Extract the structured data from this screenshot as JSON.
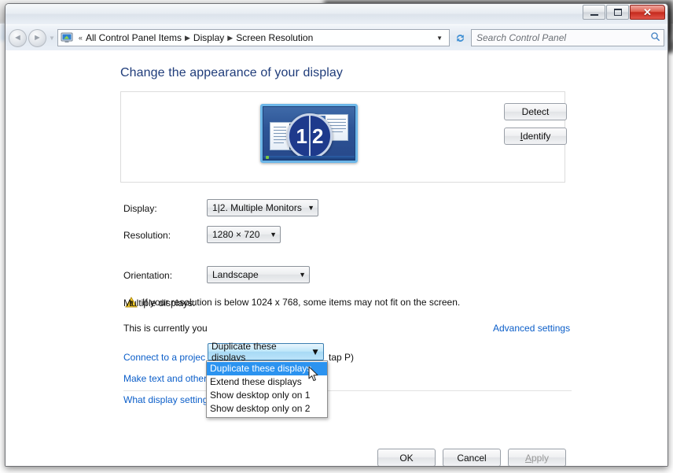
{
  "window": {
    "minimize_label": "Minimize",
    "maximize_label": "Maximize",
    "close_label": "✕"
  },
  "addressbar": {
    "back_glyph": "◄",
    "forward_glyph": "►",
    "history_glyph": "▼",
    "crumb_icon": "display-icon",
    "overflow": "«",
    "crumbs": [
      "All Control Panel Items",
      "Display",
      "Screen Resolution"
    ],
    "separator": "▶",
    "dropdown_glyph": "▼",
    "refresh_glyph": "↻",
    "search_placeholder": "Search Control Panel",
    "search_glyph": "⌕"
  },
  "main": {
    "page_title": "Change the appearance of your display",
    "preview": {
      "badge_left": "1",
      "badge_right": "2"
    },
    "buttons": {
      "detect": "Detect",
      "identify_pre": "I",
      "identify_post": "dentify"
    },
    "fields": {
      "display_label": "Display:",
      "display_value": "1|2. Multiple Monitors",
      "resolution_label": "Resolution:",
      "resolution_value": "1280 × 720",
      "orientation_label": "Orientation:",
      "orientation_value": "Landscape",
      "multiple_label": "Multiple displays:",
      "multiple_value": "Duplicate these displays",
      "arrow_glyph": "▼"
    },
    "warning": {
      "icon": "warning-triangle-icon",
      "text": "If your resolution is below 1024 x 768, some items may not fit on the screen."
    },
    "dropdown_options": [
      "Duplicate these displays",
      "Extend these displays",
      "Show desktop only on 1",
      "Show desktop only on 2"
    ],
    "dropdown_selected_index": 0,
    "main_display_text": "This is currently you",
    "advanced_link": "Advanced settings",
    "projector_link_visible_start": "Connect to a projec",
    "projector_link_visible_end": "tap P)",
    "links": [
      "Make text and other items larger or smaller",
      "What display settings should I choose?"
    ],
    "footer_buttons": {
      "ok": "OK",
      "cancel": "Cancel",
      "apply_pre": "A",
      "apply_post": "pply",
      "apply_disabled": true
    }
  },
  "colors": {
    "title_blue": "#1f3c7a",
    "link_blue": "#0b5ec9",
    "highlight_blue": "#2b93f0",
    "combo_hover_blue": "#bde6fa",
    "warning_amber": "#f5c518",
    "close_red": "#c4291c"
  }
}
